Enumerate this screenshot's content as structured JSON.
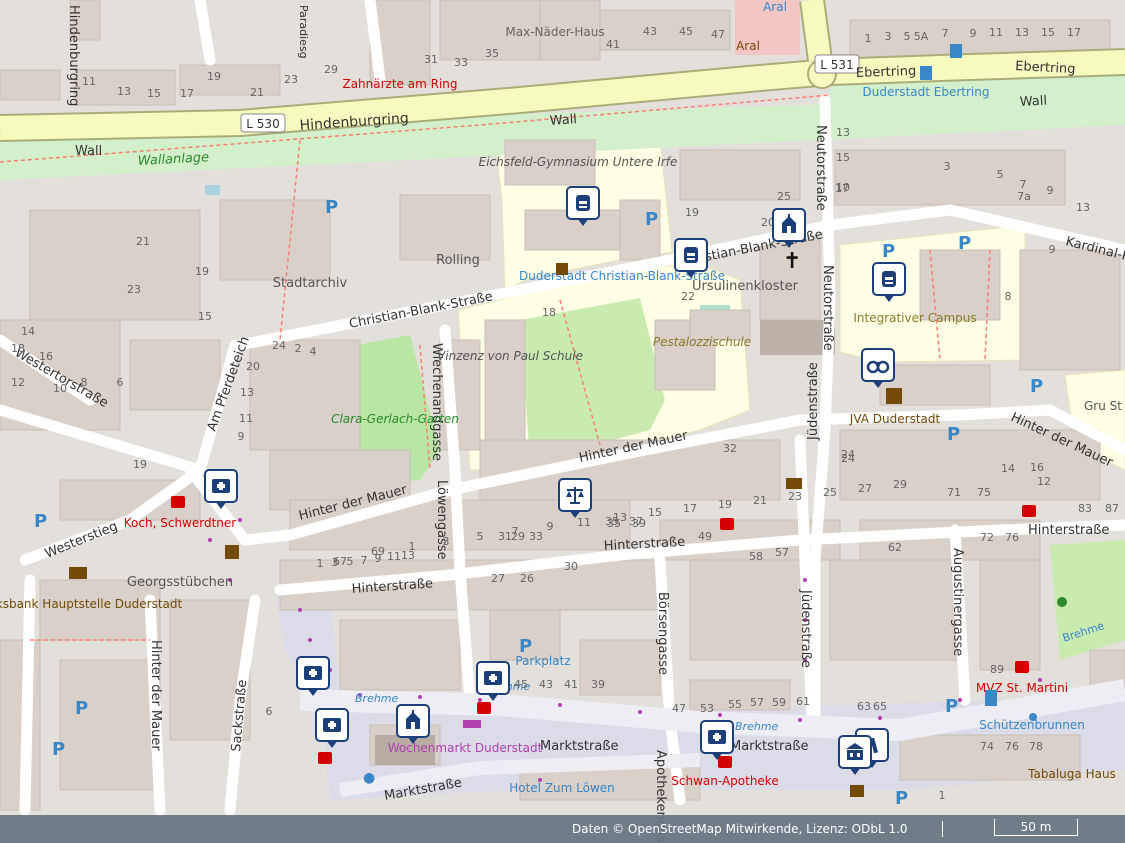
{
  "attribution": {
    "text": "Daten © OpenStreetMap Mitwirkende, Lizenz: ODbL 1.0",
    "scale_label": "50 m"
  },
  "colors": {
    "primary_road": "#f7fabf",
    "primary_casing": "#a9ad7a",
    "pedestrian": "#dddde8",
    "grass": "#cdebb0",
    "school": "#ffffe5",
    "building": "#d9d0c9",
    "marker_blue": "#1c3f7a",
    "poi_red": "#d40000",
    "poi_brown": "#734a08",
    "transit_blue": "#0092da"
  },
  "map": {
    "route_refs": [
      "L 530",
      "L 531"
    ],
    "streets": [
      "Hindenburgring",
      "Wall",
      "Wall",
      "Wall",
      "Wallanlage",
      "Ebertring",
      "Ebertring",
      "Christian-Blank-Straße",
      "Christian-Blank-Straße",
      "Hinter der Mauer",
      "Hinter der Mauer",
      "Hinter der Mauer",
      "Hinterstraße",
      "Hinterstraße",
      "Hinterstraße",
      "Marktstraße",
      "Marktstraße",
      "Marktstraße",
      "Neutorstraße",
      "Neutorstraße",
      "Jüdenstraße",
      "Jüdenstraße",
      "Augustinergasse",
      "Börsengasse",
      "Apothekengasse",
      "Löwengasse",
      "Wiechenandgasse",
      "Westerstieg",
      "Westertorstraße",
      "Am Pferdeteich",
      "Sackstraße",
      "Hinter der Mauer",
      "Kardinal-K",
      "Brehme",
      "Brehme",
      "Brehme",
      "Brehme",
      "Hindenburgring",
      "Paradiesg"
    ],
    "places": [
      "Zahnärzte am Ring",
      "Max-Näder-Haus",
      "Aral",
      "Aral",
      "Duderstadt Ebertring",
      "Eichsfeld-Gymnasium Untere Irfe",
      "Duderstadt Christian-Blank-Straße",
      "Ursulinenkloster",
      "Integrativer Campus",
      "Pestalozzischule",
      "Vinzenz von Paul Schule",
      "Clara-Gerlach-Garten",
      "Stadtarchiv",
      "Rolling",
      "JVA Duderstadt",
      "Koch, Schwerdtner",
      "Georgsstübchen",
      "Volksbank Hauptstelle Duderstadt",
      "Wochenmarkt Duderstadt",
      "Hotel Zum Löwen",
      "Schwan-Apotheke",
      "MVZ St. Martini",
      "Schützenbrunnen",
      "Tabaluga Haus",
      "Parkplatz",
      "Gru St Gr"
    ],
    "house_numbers": [
      "11",
      "13",
      "15",
      "17",
      "19",
      "21",
      "23",
      "29",
      "31",
      "33",
      "35",
      "41",
      "43",
      "45",
      "47",
      "1",
      "3",
      "5",
      "5A",
      "7",
      "9",
      "11",
      "13",
      "15",
      "17",
      "18",
      "19",
      "20",
      "22",
      "24",
      "25",
      "13",
      "15",
      "17",
      "19",
      "21",
      "23",
      "3",
      "5",
      "7",
      "7a",
      "9",
      "13",
      "10",
      "16",
      "12",
      "14",
      "2",
      "4",
      "15",
      "9",
      "11",
      "13",
      "19",
      "24",
      "20",
      "18",
      "16",
      "14",
      "12",
      "10",
      "8",
      "6",
      "1",
      "3",
      "5",
      "7",
      "9",
      "11",
      "13",
      "8",
      "9",
      "32",
      "30",
      "24",
      "27",
      "26",
      "29",
      "33",
      "35",
      "37",
      "39",
      "41",
      "43",
      "45",
      "47",
      "53",
      "55",
      "57",
      "59",
      "61",
      "63",
      "65",
      "67",
      "69",
      "1",
      "3",
      "5",
      "7",
      "9",
      "11",
      "13",
      "15",
      "17",
      "19",
      "21",
      "23",
      "25",
      "27",
      "29",
      "31",
      "35",
      "39",
      "49",
      "58",
      "57",
      "62",
      "71",
      "75",
      "72",
      "76",
      "83",
      "87",
      "89",
      "74",
      "76",
      "78",
      "1",
      "2",
      "6"
    ],
    "markers": [
      {
        "name": "school"
      },
      {
        "name": "school"
      },
      {
        "name": "school"
      },
      {
        "name": "church"
      },
      {
        "name": "viewpoint"
      },
      {
        "name": "courthouse"
      },
      {
        "name": "doctor"
      },
      {
        "name": "doctor"
      },
      {
        "name": "doctor"
      },
      {
        "name": "doctor"
      },
      {
        "name": "church"
      },
      {
        "name": "doctor"
      },
      {
        "name": "library"
      },
      {
        "name": "townhall"
      }
    ]
  }
}
